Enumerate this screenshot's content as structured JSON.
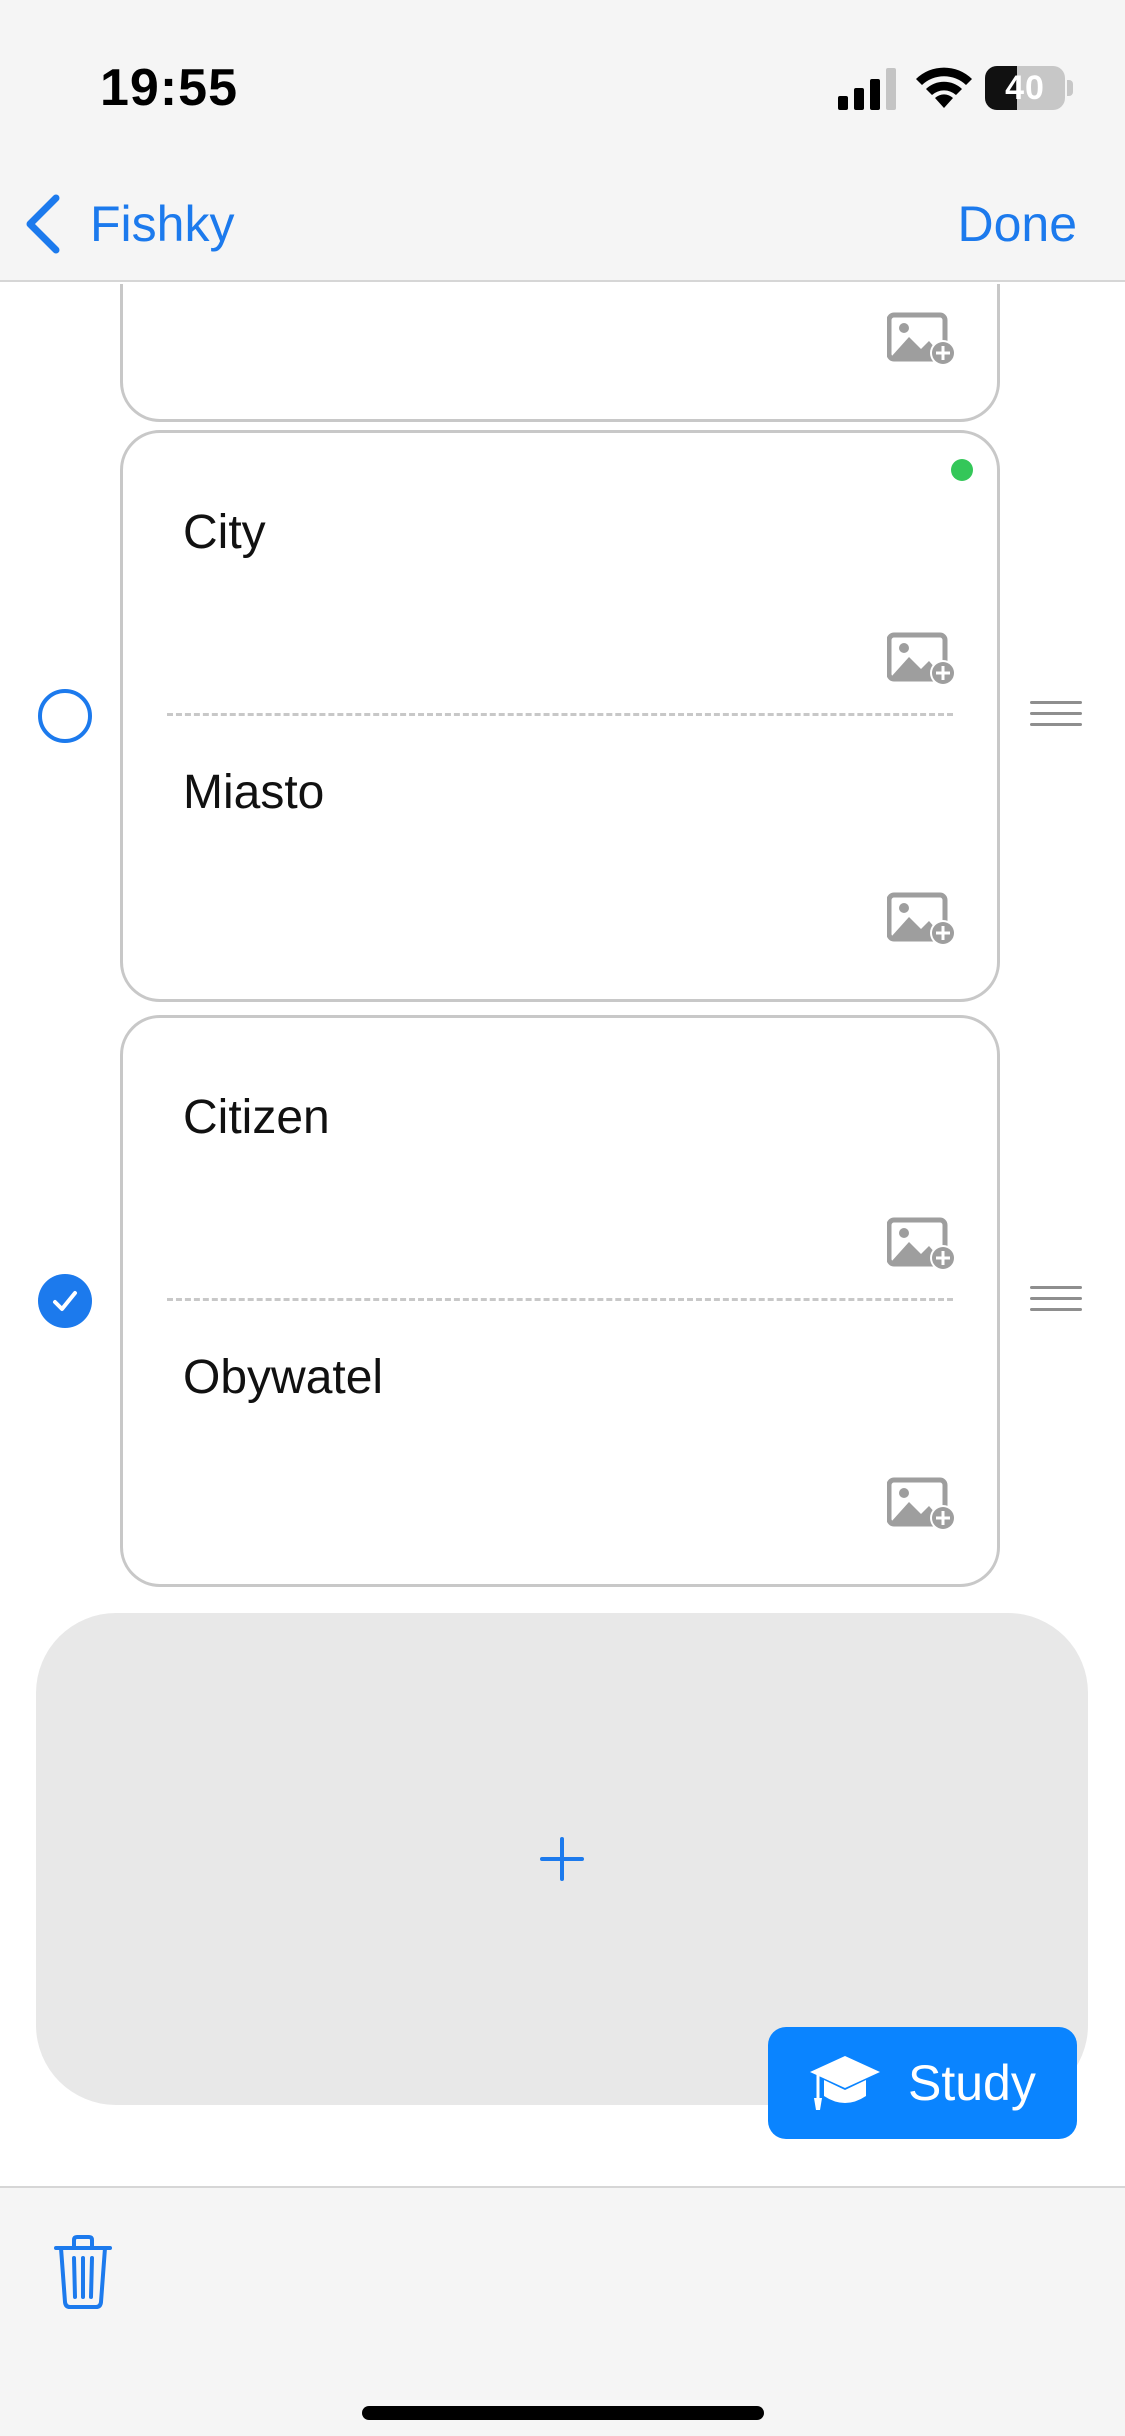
{
  "status_bar": {
    "time": "19:55",
    "battery_level": "40",
    "battery_fraction": 0.4
  },
  "nav": {
    "back_label": "Fishky",
    "done_label": "Done",
    "icons": {
      "back": "chevron-left-icon"
    }
  },
  "cards": [
    {
      "front": "City",
      "back": "Miasto",
      "selected": false,
      "active": true
    },
    {
      "front": "Citizen",
      "back": "Obywatel",
      "selected": true,
      "active": false
    }
  ],
  "add_card": {
    "icon": "plus-icon"
  },
  "study_button": {
    "label": "Study",
    "icon": "graduation-cap-icon"
  },
  "toolbar": {
    "icon": "trash-icon"
  },
  "colors": {
    "accent": "#1c7aed",
    "study_button": "#0a84ff",
    "active_dot": "#34c759",
    "card_border": "#c8c8c8",
    "add_card_bg": "#e8e8e8"
  }
}
